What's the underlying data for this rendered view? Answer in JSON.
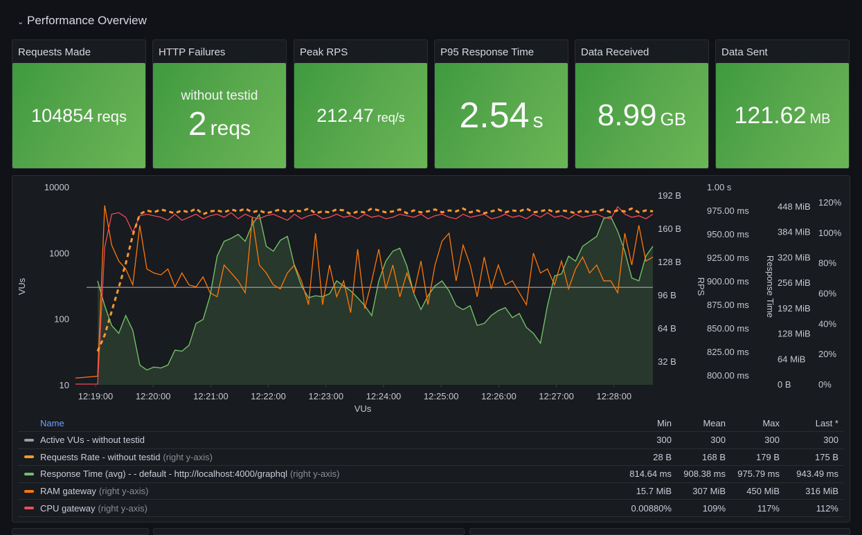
{
  "row": {
    "title": "Performance Overview",
    "chevron_icon": "chevron-down-icon"
  },
  "stats": [
    {
      "title": "Requests Made",
      "subtitle": "",
      "value": "104854",
      "unit": "reqs"
    },
    {
      "title": "HTTP Failures",
      "subtitle": "without testid",
      "value": "2",
      "unit": "reqs"
    },
    {
      "title": "Peak RPS",
      "subtitle": "",
      "value": "212.47",
      "unit": "req/s"
    },
    {
      "title": "P95 Response Time",
      "subtitle": "",
      "value": "2.54",
      "unit": "s"
    },
    {
      "title": "Data Received",
      "subtitle": "",
      "value": "8.99",
      "unit": "GB"
    },
    {
      "title": "Data Sent",
      "subtitle": "",
      "value": "121.62",
      "unit": "MB"
    }
  ],
  "colors": {
    "stat_green": "#56a64b",
    "vus": "#9e9e9e",
    "requests_rate": "#ff9830",
    "response_time": "#73bf69",
    "ram": "#ff780a",
    "cpu": "#f2495c",
    "legend_header": "#6e9fff"
  },
  "chart_data": {
    "type": "line",
    "title": "",
    "xlabel": "VUs",
    "x_ticks": [
      "12:19:00",
      "12:20:00",
      "12:21:00",
      "12:22:00",
      "12:23:00",
      "12:24:00",
      "12:25:00",
      "12:26:00",
      "12:27:00",
      "12:28:00"
    ],
    "axes": {
      "left": {
        "label": "VUs",
        "scale": "log",
        "ticks": [
          "10",
          "100",
          "1000",
          "10000"
        ],
        "range": [
          10,
          10000
        ]
      },
      "right_rps": {
        "label": "RPS",
        "ticks": [
          "32 B",
          "64 B",
          "96 B",
          "128 B",
          "160 B",
          "192 B"
        ],
        "range": [
          0,
          200
        ]
      },
      "right_response": {
        "label": "Response Time",
        "ticks": [
          "800.00 ms",
          "825.00 ms",
          "850.00 ms",
          "875.00 ms",
          "900.00 ms",
          "925.00 ms",
          "950.00 ms",
          "975.00 ms",
          "1.00 s"
        ],
        "range": [
          800,
          1000
        ]
      },
      "right_ram": {
        "label": "",
        "ticks": [
          "0 B",
          "64 MiB",
          "128 MiB",
          "192 MiB",
          "256 MiB",
          "320 MiB",
          "384 MiB",
          "448 MiB"
        ],
        "range": [
          0,
          480
        ]
      },
      "right_cpu": {
        "label": "",
        "ticks": [
          "0%",
          "20%",
          "40%",
          "60%",
          "80%",
          "100%",
          "120%"
        ],
        "range": [
          0,
          125
        ]
      }
    },
    "series": [
      {
        "name": "Active VUs - without testid",
        "axis": "left",
        "style": "solid",
        "values": [
          300,
          300,
          300,
          300,
          300,
          300,
          300,
          300,
          300,
          300,
          300,
          300,
          300,
          300,
          300,
          300,
          300,
          300,
          300,
          300,
          300,
          300,
          300,
          300,
          300,
          300,
          300,
          300,
          300,
          300,
          300,
          300,
          300,
          300,
          300,
          300,
          300,
          300,
          300,
          300,
          300,
          300,
          300,
          300,
          300,
          300,
          300,
          300,
          300,
          300,
          300,
          300,
          300,
          300,
          300,
          300,
          300,
          300,
          300,
          300,
          300,
          300,
          300,
          300,
          300,
          300,
          300,
          300,
          300,
          300,
          300,
          300,
          300,
          300,
          300,
          300,
          300,
          300,
          300,
          300
        ]
      },
      {
        "name": "Requests Rate - without testid",
        "axis": "right_rps",
        "style": "dashed",
        "values": [
          28,
          45,
          70,
          95,
          120,
          150,
          172,
          176,
          174,
          177,
          175,
          173,
          176,
          174,
          178,
          172,
          175,
          176,
          174,
          177,
          175,
          178,
          174,
          176,
          173,
          175,
          177,
          174,
          176,
          175,
          178,
          173,
          175,
          174,
          177,
          176,
          172,
          175,
          174,
          178,
          176,
          174,
          175,
          177,
          173,
          176,
          174,
          175,
          177,
          174,
          176,
          175,
          178,
          174,
          176,
          173,
          175,
          177,
          174,
          176,
          175,
          178,
          174,
          175,
          177,
          174,
          176,
          175,
          173,
          176,
          174,
          175,
          177,
          174,
          176,
          175,
          178,
          174,
          176,
          175
        ]
      },
      {
        "name": "Response Time (avg) - - default - http://localhost:4000/graphql",
        "axis": "right_response",
        "style": "area",
        "values": [
          905,
          880,
          860,
          852,
          870,
          855,
          820,
          815,
          818,
          817,
          820,
          835,
          834,
          840,
          862,
          866,
          890,
          930,
          945,
          948,
          952,
          945,
          962,
          972,
          940,
          935,
          946,
          950,
          920,
          900,
          888,
          890,
          889,
          892,
          905,
          900,
          895,
          888,
          880,
          870,
          905,
          925,
          935,
          938,
          920,
          892,
          876,
          890,
          900,
          905,
          895,
          880,
          876,
          880,
          860,
          862,
          870,
          875,
          878,
          868,
          872,
          858,
          852,
          842,
          880,
          910,
          912,
          930,
          925,
          940,
          945,
          950,
          968,
          970,
          955,
          935,
          908,
          905,
          930,
          940
        ]
      },
      {
        "name": "RAM gateway",
        "axis": "right_ram",
        "style": "solid",
        "values": [
          20,
          450,
          350,
          310,
          290,
          250,
          400,
          290,
          280,
          275,
          290,
          245,
          280,
          250,
          245,
          270,
          230,
          220,
          300,
          280,
          260,
          230,
          420,
          300,
          280,
          250,
          240,
          280,
          300,
          260,
          200,
          380,
          200,
          300,
          220,
          260,
          180,
          340,
          190,
          260,
          340,
          240,
          300,
          220,
          280,
          230,
          310,
          200,
          300,
          360,
          380,
          260,
          350,
          300,
          220,
          320,
          240,
          300,
          250,
          260,
          230,
          200,
          330,
          280,
          290,
          250,
          310,
          240,
          290,
          320,
          280,
          300,
          260,
          260,
          230,
          380,
          300,
          400,
          310,
          320
        ]
      },
      {
        "name": "CPU gateway",
        "axis": "right_cpu",
        "style": "solid",
        "values": [
          0.0088,
          90,
          112,
          113,
          110,
          100,
          111,
          112,
          111,
          110,
          108,
          112,
          108,
          110,
          112,
          109,
          111,
          112,
          110,
          113,
          109,
          112,
          110,
          109,
          111,
          112,
          110,
          108,
          112,
          109,
          111,
          112,
          109,
          110,
          112,
          110,
          111,
          109,
          112,
          110,
          111,
          109,
          110,
          112,
          111,
          110,
          112,
          109,
          111,
          112,
          110,
          109,
          112,
          110,
          111,
          112,
          109,
          110,
          112,
          110,
          111,
          109,
          112,
          110,
          113,
          110,
          111,
          109,
          112,
          110,
          111,
          112,
          110,
          109,
          117,
          112,
          110,
          111,
          109,
          112
        ]
      }
    ],
    "legend": {
      "columns": [
        "Name",
        "Min",
        "Mean",
        "Max",
        "Last *"
      ],
      "rows": [
        {
          "name": "Active VUs - without testid",
          "note": "",
          "min": "300",
          "mean": "300",
          "max": "300",
          "last": "300"
        },
        {
          "name": "Requests Rate - without testid",
          "note": "(right y-axis)",
          "min": "28 B",
          "mean": "168 B",
          "max": "179 B",
          "last": "175 B"
        },
        {
          "name": "Response Time (avg) - - default - http://localhost:4000/graphql",
          "note": "(right y-axis)",
          "min": "814.64 ms",
          "mean": "908.38 ms",
          "max": "975.79 ms",
          "last": "943.49 ms"
        },
        {
          "name": "RAM gateway",
          "note": "(right y-axis)",
          "min": "15.7 MiB",
          "mean": "307 MiB",
          "max": "450 MiB",
          "last": "316 MiB"
        },
        {
          "name": "CPU gateway",
          "note": "(right y-axis)",
          "min": "0.00880%",
          "mean": "109%",
          "max": "117%",
          "last": "112%"
        }
      ]
    },
    "grid": false,
    "legend_placement": "bottom"
  }
}
